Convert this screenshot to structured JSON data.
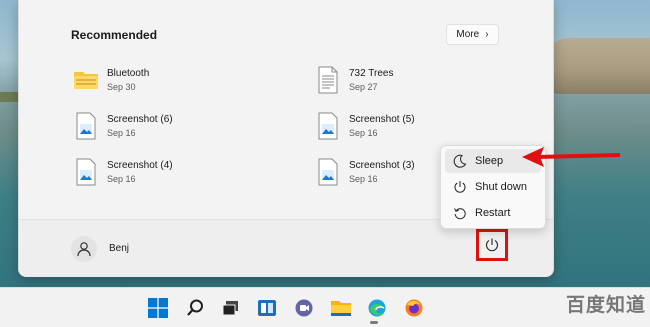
{
  "start_menu": {
    "recommended_title": "Recommended",
    "more_label": "More",
    "items": [
      {
        "name": "Bluetooth",
        "date": "Sep 30",
        "icon": "folder-icon"
      },
      {
        "name": "732 Trees",
        "date": "Sep 27",
        "icon": "text-file-icon"
      },
      {
        "name": "Screenshot (6)",
        "date": "Sep 16",
        "icon": "image-file-icon"
      },
      {
        "name": "Screenshot (5)",
        "date": "Sep 16",
        "icon": "image-file-icon"
      },
      {
        "name": "Screenshot (4)",
        "date": "Sep 16",
        "icon": "image-file-icon"
      },
      {
        "name": "Screenshot (3)",
        "date": "Sep 16",
        "icon": "image-file-icon"
      }
    ],
    "user_name": "Benj"
  },
  "power_menu": {
    "items": [
      {
        "label": "Sleep",
        "icon": "moon-icon",
        "active": true
      },
      {
        "label": "Shut down",
        "icon": "power-icon",
        "active": false
      },
      {
        "label": "Restart",
        "icon": "restart-icon",
        "active": false
      }
    ]
  },
  "taskbar": {
    "icons": [
      "windows-start-icon",
      "search-icon",
      "task-view-icon",
      "widgets-icon",
      "teams-chat-icon",
      "file-explorer-icon",
      "edge-icon",
      "firefox-icon"
    ]
  },
  "watermark": "百度知道",
  "colors": {
    "highlight_red": "#e01010",
    "accent_blue": "#0078d4"
  }
}
